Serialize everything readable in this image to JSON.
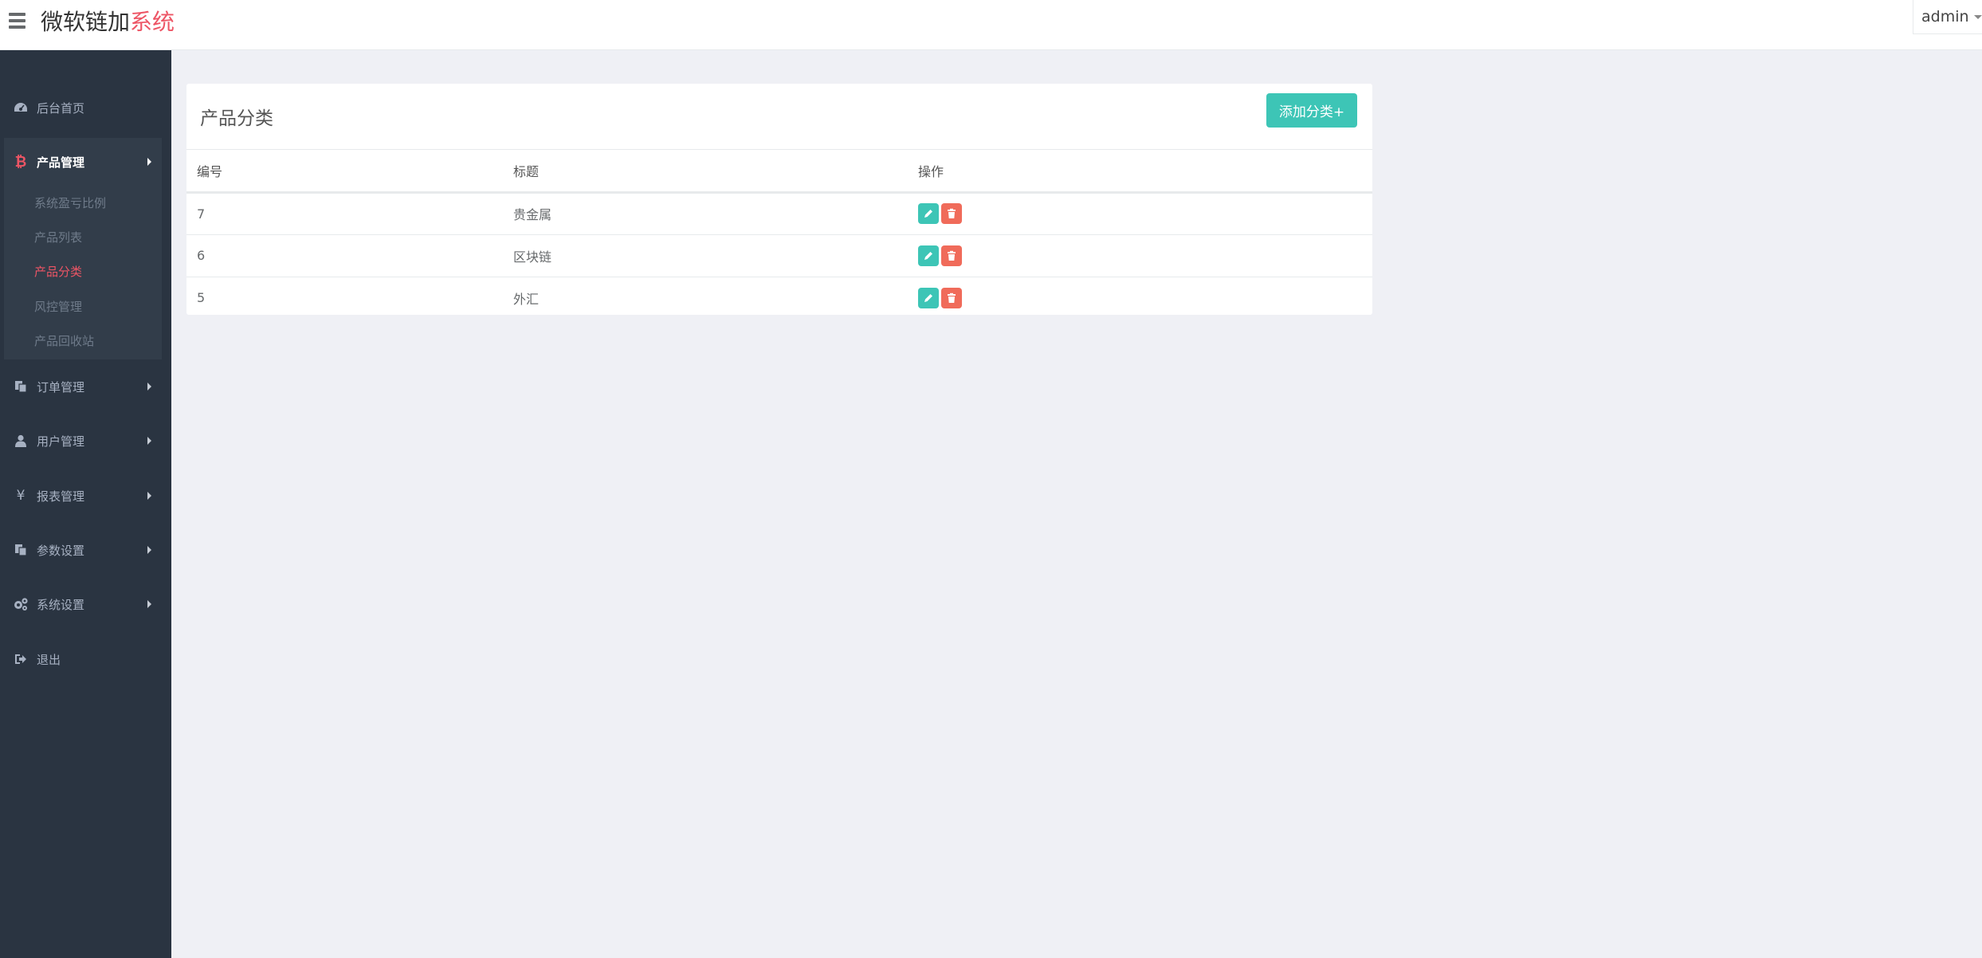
{
  "header": {
    "brand_main": "微软链加",
    "brand_accent": "系统",
    "user": "admin"
  },
  "sidebar": {
    "items": [
      {
        "label": "后台首页",
        "icon": "dashboard-icon"
      },
      {
        "label": "产品管理",
        "icon": "bitcoin-icon",
        "expanded": true
      },
      {
        "label": "订单管理",
        "icon": "copy-icon"
      },
      {
        "label": "用户管理",
        "icon": "user-icon"
      },
      {
        "label": "报表管理",
        "icon": "yen-icon"
      },
      {
        "label": "参数设置",
        "icon": "copy-icon"
      },
      {
        "label": "系统设置",
        "icon": "gears-icon"
      },
      {
        "label": "退出",
        "icon": "sign-out-icon"
      }
    ],
    "subitems": [
      {
        "label": "系统盈亏比例"
      },
      {
        "label": "产品列表"
      },
      {
        "label": "产品分类",
        "current": true
      },
      {
        "label": "风控管理"
      },
      {
        "label": "产品回收站"
      }
    ]
  },
  "panel": {
    "title": "产品分类",
    "add_button": "添加分类+",
    "columns": [
      "编号",
      "标题",
      "操作"
    ],
    "rows": [
      {
        "id": "7",
        "title": "贵金属"
      },
      {
        "id": "6",
        "title": "区块链"
      },
      {
        "id": "5",
        "title": "外汇"
      }
    ]
  },
  "colors": {
    "accent": "#ed5565",
    "teal": "#3dc5b6",
    "danger": "#f06b5a",
    "sidebar": "#2a3441"
  }
}
